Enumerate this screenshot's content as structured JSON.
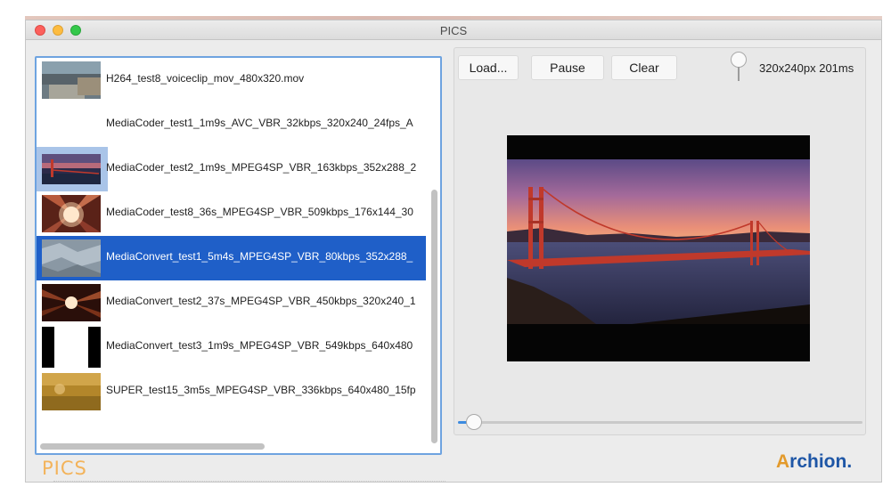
{
  "window": {
    "title": "PICS"
  },
  "file_list": {
    "items": [
      {
        "label": "H264_test8_voiceclip_mov_480x320.mov",
        "thumb": "landscape-dim"
      },
      {
        "label": "MediaCoder_test1_1m9s_AVC_VBR_32kbps_320x240_24fps_A",
        "thumb": "none"
      },
      {
        "label": "MediaCoder_test2_1m9s_MPEG4SP_VBR_163kbps_352x288_2",
        "thumb": "bridge"
      },
      {
        "label": "MediaCoder_test8_36s_MPEG4SP_VBR_509kbps_176x144_30",
        "thumb": "light-burst"
      },
      {
        "label": "MediaConvert_test1_5m4s_MPEG4SP_VBR_80kbps_352x288_",
        "thumb": "grey-texture"
      },
      {
        "label": "MediaConvert_test2_37s_MPEG4SP_VBR_450kbps_320x240_1",
        "thumb": "light-burst-dark"
      },
      {
        "label": "MediaConvert_test3_1m9s_MPEG4SP_VBR_549kbps_640x480",
        "thumb": "black-white"
      },
      {
        "label": "SUPER_test15_3m5s_MPEG4SP_VBR_336kbps_640x480_15fp",
        "thumb": "golden"
      }
    ],
    "selected_index": 4
  },
  "toolbar": {
    "load_label": "Load...",
    "pause_label": "Pause",
    "clear_label": "Clear",
    "info": "320x240px 201ms"
  },
  "player": {
    "seek_progress": 0.04
  },
  "branding": {
    "left_logo": "PICS",
    "right_logo": "Archion."
  },
  "colors": {
    "selection": "#1f5fc8",
    "focus_ring": "#6ea3e0",
    "pics_logo": "#f3b35a",
    "archion_blue": "#1e56a6",
    "archion_orange": "#e39a2b"
  }
}
